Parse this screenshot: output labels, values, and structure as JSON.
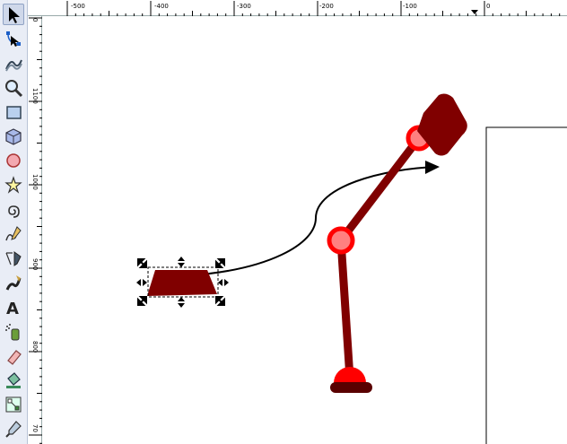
{
  "tools": [
    {
      "name": "selector-tool-icon",
      "active": true
    },
    {
      "name": "node-editor-tool-icon"
    },
    {
      "name": "tweak-tool-icon"
    },
    {
      "name": "zoom-tool-icon"
    },
    {
      "name": "rectangle-tool-icon"
    },
    {
      "name": "3d-box-tool-icon"
    },
    {
      "name": "ellipse-tool-icon"
    },
    {
      "name": "star-tool-icon"
    },
    {
      "name": "spiral-tool-icon"
    },
    {
      "name": "pencil-tool-icon"
    },
    {
      "name": "pen-tool-icon"
    },
    {
      "name": "calligraphy-tool-icon"
    },
    {
      "name": "text-tool-icon"
    },
    {
      "name": "spray-tool-icon"
    },
    {
      "name": "eraser-tool-icon"
    },
    {
      "name": "paint-bucket-tool-icon"
    },
    {
      "name": "gradient-tool-icon"
    },
    {
      "name": "dropper-tool-icon"
    }
  ],
  "ruler": {
    "horizontal_labels": [
      "-500",
      "-400",
      "-300",
      "-200",
      "-100",
      "0"
    ],
    "vertical_labels": [
      "0",
      "1100",
      "1000",
      "900",
      "800",
      "70"
    ]
  },
  "colors": {
    "limb": "#800000",
    "joint_ring": "#ff0000",
    "joint_fill": "#ff8080",
    "foot": "#5a0000",
    "connector": "#000000"
  }
}
